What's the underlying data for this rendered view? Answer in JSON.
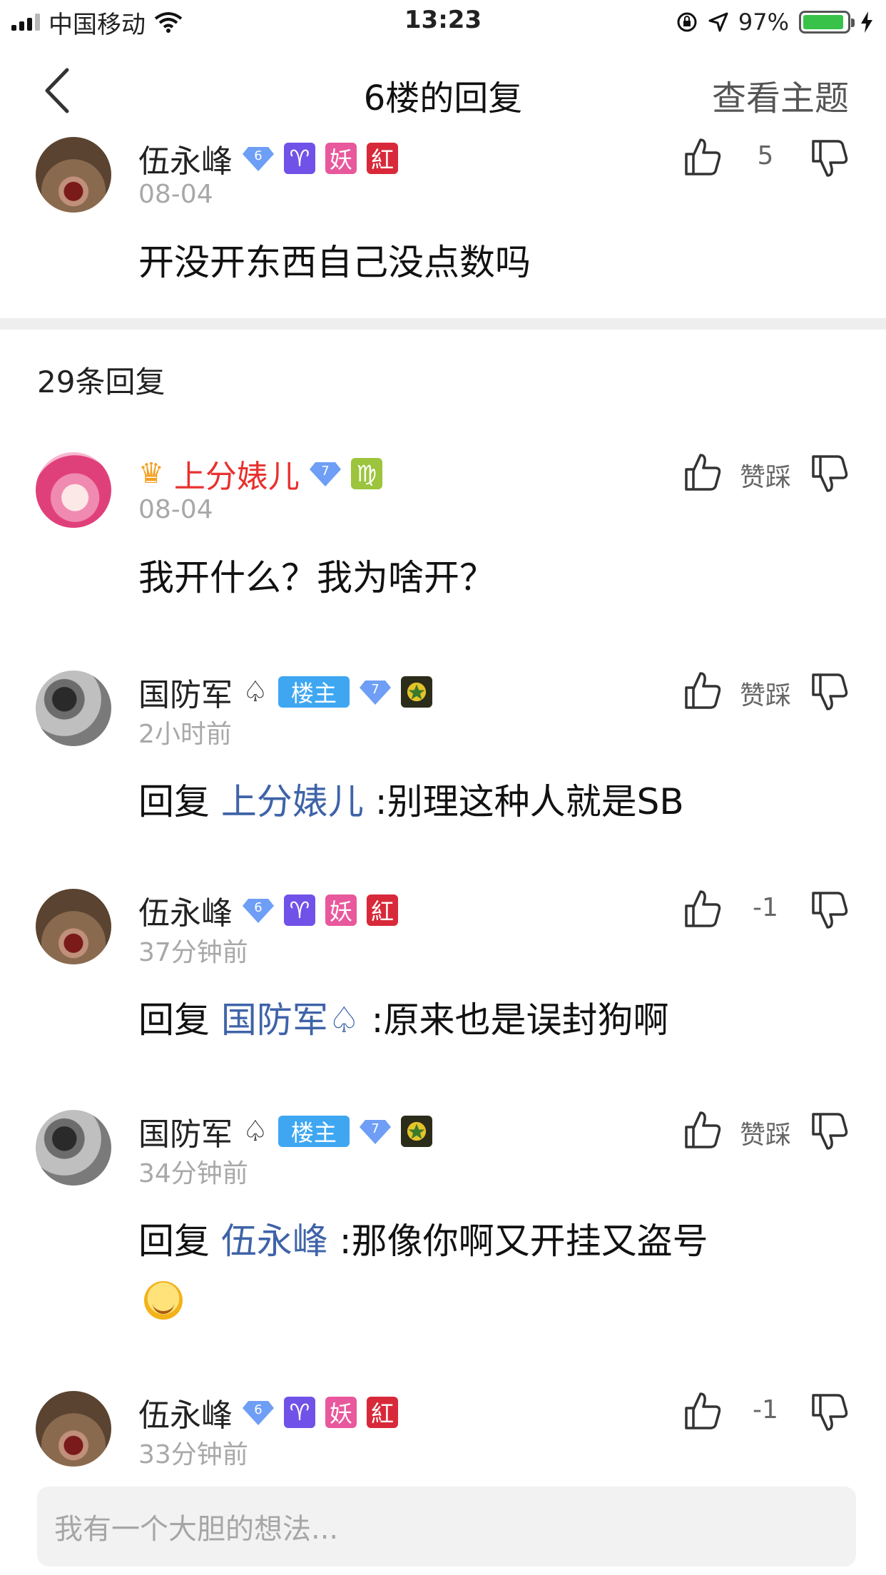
{
  "status_bar": {
    "carrier": "中国移动",
    "time": "13:23",
    "battery": "97%"
  },
  "nav": {
    "title": "6楼的回复",
    "action": "查看主题"
  },
  "main_post": {
    "username": "伍永峰",
    "level": "6",
    "badges": [
      "♈",
      "妖",
      "紅"
    ],
    "time": "08-04",
    "content": "开没开东西自己没点数吗",
    "likes": "5"
  },
  "reply_count": "29条回复",
  "replies": [
    {
      "username": "上分婊儿",
      "level": "7",
      "badge": "♍",
      "time": "08-04",
      "content": "我开什么？我为啥开？",
      "vote": "赞踩"
    },
    {
      "username": "国防军",
      "level": "7",
      "tag": "楼主",
      "time": "2小时前",
      "prefix": "回复 ",
      "target": "上分婊儿",
      "content": " :别理这种人就是SB",
      "vote": "赞踩"
    },
    {
      "username": "伍永峰",
      "level": "6",
      "badges": [
        "♈",
        "妖",
        "紅"
      ],
      "time": "37分钟前",
      "prefix": "回复 ",
      "target": "国防军♤",
      "content": " :原来也是误封狗啊",
      "vote": "-1"
    },
    {
      "username": "国防军",
      "level": "7",
      "tag": "楼主",
      "time": "34分钟前",
      "prefix": "回复 ",
      "target": "伍永峰",
      "content": " :那像你啊又开挂又盗号",
      "vote": "赞踩"
    },
    {
      "username": "伍永峰",
      "level": "6",
      "badges": [
        "♈",
        "妖",
        "紅"
      ],
      "time": "33分钟前",
      "vote": "-1"
    }
  ],
  "input": {
    "placeholder": "我有一个大胆的想法..."
  },
  "colors": {
    "link": "#3f63a8",
    "vip_name": "#e8312f",
    "louzhu": "#3fa7f2"
  }
}
